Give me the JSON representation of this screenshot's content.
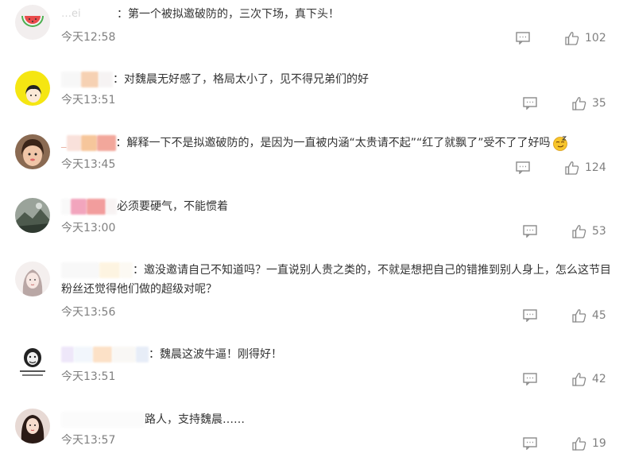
{
  "comments": [
    {
      "username": "…ei",
      "separator": "：",
      "text": "第一个被拟邀破防的，三次下场，真下头！",
      "time": "今天12:58",
      "likes": "102",
      "avatar": "watermelon-icon"
    },
    {
      "username": "",
      "separator": "：",
      "text": "对魏晨无好感了，格局太小了，见不得兄弟们的好",
      "time": "今天13:51",
      "likes": "35",
      "avatar": "cartoon-girl"
    },
    {
      "username": "_",
      "separator": "：",
      "text": "解释一下不是拟邀破防的，是因为一直被内涵“太贵请不起”“红了就飘了”受不了了好吗",
      "time": "今天13:45",
      "likes": "124",
      "avatar": "girl-photo",
      "emoji": "smug-face-emoji"
    },
    {
      "username": "",
      "separator": "",
      "text": "必须要硬气，不能惯着",
      "time": "今天13:00",
      "likes": "53",
      "avatar": "landscape-photo"
    },
    {
      "username": "",
      "separator": "：",
      "text": "邀没邀请自己不知道吗？一直说别人贵之类的，不就是想把自己的错推到别人身上，怎么这节目粉丝还觉得他们做的超级对呢？",
      "time": "今天13:56",
      "likes": "45",
      "avatar": "girl-sketch"
    },
    {
      "username": "",
      "separator": "：",
      "text": "魏晨这波牛逼！刚得好！",
      "time": "今天13:51",
      "likes": "42",
      "avatar": "meme-face"
    },
    {
      "username": "",
      "separator": "",
      "text": "路人，支持魏晨……",
      "time": "今天13:57",
      "likes": "19",
      "avatar": "long-hair-girl"
    }
  ],
  "colors": {
    "text": "#333333",
    "meta": "#808080",
    "icon": "#8a8a8a"
  }
}
